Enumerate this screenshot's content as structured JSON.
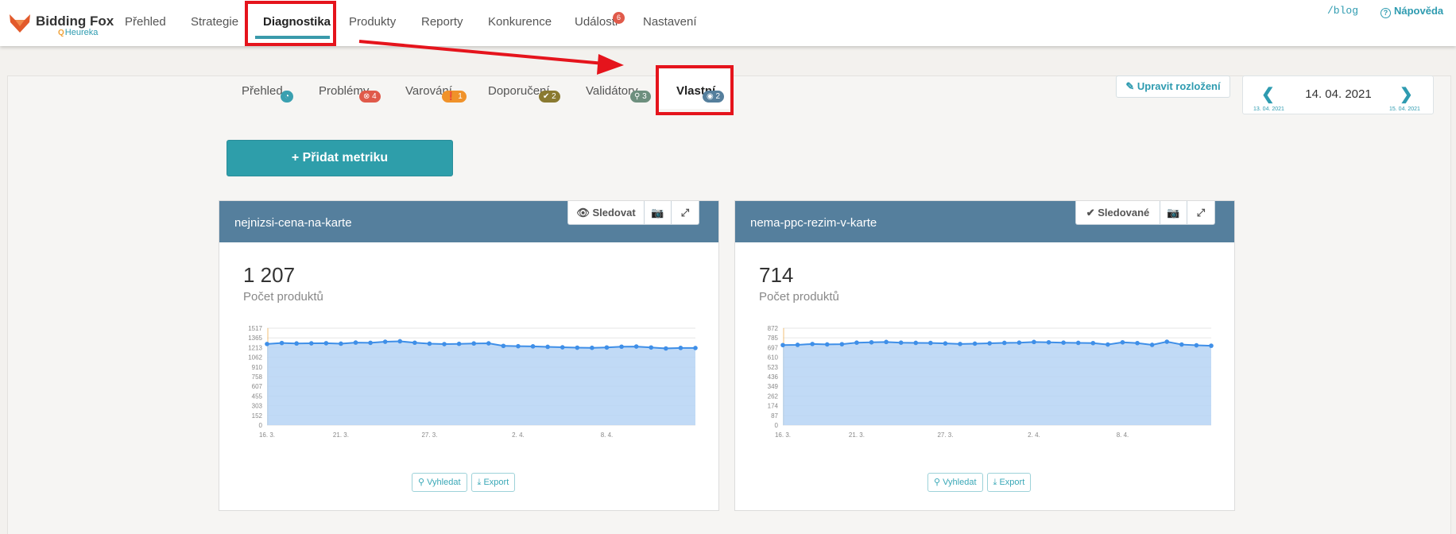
{
  "brand": {
    "name": "Bidding Fox",
    "sub": "Heureka"
  },
  "nav": {
    "items": [
      "Přehled",
      "Strategie",
      "Diagnostika",
      "Produkty",
      "Reporty",
      "Konkurence",
      "Události",
      "Nastavení"
    ],
    "active": "Diagnostika",
    "events_badge": "6",
    "blog": "/blog",
    "help": "Nápověda"
  },
  "subtabs": [
    {
      "label": "Přehled",
      "badge": "",
      "color": "#3aa0b0"
    },
    {
      "label": "Problémy",
      "badge": "4",
      "color": "#e05a4a"
    },
    {
      "label": "Varování",
      "badge": "1",
      "color": "#f0922a"
    },
    {
      "label": "Doporučení",
      "badge": "2",
      "color": "#8a7a30"
    },
    {
      "label": "Validátory",
      "badge": "3",
      "color": "#6d8f7e"
    },
    {
      "label": "Vlastní",
      "badge": "2",
      "color": "#557f9d"
    }
  ],
  "edit_layout": "Upravit rozložení",
  "date": {
    "current": "14. 04. 2021",
    "prev": "13. 04. 2021",
    "next": "15. 04. 2021"
  },
  "add_metric": "+ Přidat metriku",
  "cards": [
    {
      "title": "nejnizsi-cena-na-karte",
      "follow_label": "Sledovat",
      "value": "1 207",
      "label": "Počet produktů",
      "search": "Vyhledat",
      "export": "Export"
    },
    {
      "title": "nema-ppc-rezim-v-karte",
      "follow_label": "Sledované",
      "value": "714",
      "label": "Počet produktů",
      "search": "Vyhledat",
      "export": "Export"
    }
  ],
  "chart_data": [
    {
      "type": "area",
      "yticks": [
        0,
        152,
        303,
        455,
        607,
        758,
        910,
        1062,
        1213,
        1365,
        1517
      ],
      "ylim": [
        0,
        1517
      ],
      "xticks": [
        "16. 3.",
        "21. 3.",
        "27. 3.",
        "2. 4.",
        "8. 4."
      ],
      "xtick_index": [
        0,
        5,
        11,
        17,
        23
      ],
      "values": [
        1270,
        1285,
        1278,
        1280,
        1282,
        1275,
        1292,
        1288,
        1305,
        1312,
        1290,
        1275,
        1268,
        1272,
        1278,
        1280,
        1240,
        1235,
        1233,
        1225,
        1218,
        1212,
        1210,
        1215,
        1228,
        1230,
        1215,
        1200,
        1208,
        1207
      ]
    },
    {
      "type": "area",
      "yticks": [
        0,
        87,
        174,
        262,
        349,
        436,
        523,
        610,
        697,
        785,
        872
      ],
      "ylim": [
        0,
        872
      ],
      "xticks": [
        "16. 3.",
        "21. 3.",
        "27. 3.",
        "2. 4.",
        "8. 4."
      ],
      "xtick_index": [
        0,
        5,
        11,
        17,
        23
      ],
      "values": [
        720,
        722,
        730,
        726,
        728,
        742,
        745,
        748,
        742,
        740,
        739,
        735,
        730,
        733,
        736,
        740,
        742,
        748,
        745,
        742,
        740,
        738,
        725,
        745,
        738,
        722,
        750,
        725,
        718,
        714
      ]
    }
  ]
}
